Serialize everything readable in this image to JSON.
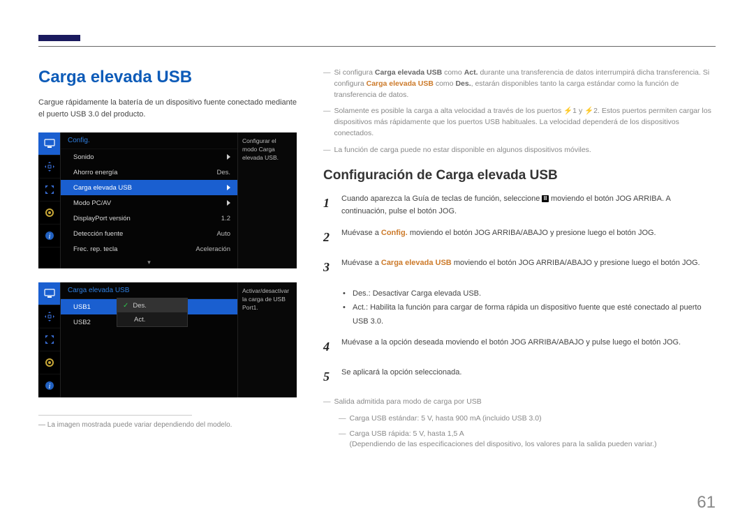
{
  "page_number": "61",
  "title": "Carga elevada USB",
  "intro": "Cargue rápidamente la batería de un dispositivo fuente conectado mediante el puerto USB 3.0 del producto.",
  "footnote": "La imagen mostrada puede variar dependiendo del modelo.",
  "osd1": {
    "header": "Config.",
    "description": "Configurar el modo Carga elevada USB.",
    "items": [
      {
        "label": "Sonido",
        "value": "",
        "arrow": true
      },
      {
        "label": "Ahorro energía",
        "value": "Des.",
        "arrow": false
      },
      {
        "label": "Carga elevada USB",
        "value": "",
        "arrow": true,
        "selected": true
      },
      {
        "label": "Modo PC/AV",
        "value": "",
        "arrow": true
      },
      {
        "label": "DisplayPort versión",
        "value": "1.2",
        "arrow": false
      },
      {
        "label": "Detección fuente",
        "value": "Auto",
        "arrow": false
      },
      {
        "label": "Frec. rep. tecla",
        "value": "Aceleración",
        "arrow": false
      }
    ]
  },
  "osd2": {
    "header": "Carga elevada USB",
    "description": "Activar/desactivar la carga de USB Port1.",
    "items": [
      {
        "label": "USB1",
        "selected": true
      },
      {
        "label": "USB2"
      }
    ],
    "options": [
      {
        "label": "Des.",
        "checked": true
      },
      {
        "label": "Act."
      }
    ]
  },
  "notes_top": {
    "n1_pre": "Si configura ",
    "n1_b1": "Carga elevada USB",
    "n1_mid1": " como ",
    "n1_b2": "Act.",
    "n1_mid2": " durante una transferencia de datos interrumpirá dicha transferencia. Si configura ",
    "n1_b3": "Carga elevada USB",
    "n1_mid3": " como ",
    "n1_b4": "Des.",
    "n1_end": ", estarán disponibles tanto la carga estándar como la función de transferencia de datos.",
    "n2": "Solamente es posible la carga a alta velocidad a través de los puertos ⚡1 y ⚡2. Estos puertos permiten cargar los dispositivos más rápidamente que los puertos USB habituales. La velocidad dependerá de los dispositivos conectados.",
    "n3": "La función de carga puede no estar disponible en algunos dispositivos móviles."
  },
  "section2_title": "Configuración de Carga elevada USB",
  "steps": {
    "s1_a": "Cuando aparezca la Guía de teclas de función, seleccione ",
    "s1_b": " moviendo el botón JOG ARRIBA. A continuación, pulse el botón JOG.",
    "s2_a": "Muévase a ",
    "s2_b": "Config.",
    "s2_c": " moviendo el botón JOG ARRIBA/ABAJO y presione luego el botón JOG.",
    "s3_a": "Muévase a ",
    "s3_b": "Carga elevada USB",
    "s3_c": " moviendo el botón JOG ARRIBA/ABAJO y presione luego el botón JOG.",
    "s4": "Muévase a la opción deseada moviendo el botón JOG ARRIBA/ABAJO y pulse luego el botón JOG.",
    "s5": "Se aplicará la opción seleccionada."
  },
  "bullets": {
    "b1_a": "Des.",
    "b1_b": ": Desactivar ",
    "b1_c": "Carga elevada USB",
    "b1_d": ".",
    "b2_a": "Act.",
    "b2_b": ": Habilita la función para cargar de forma rápida un dispositivo fuente que esté conectado al puerto USB 3.0."
  },
  "notes_bottom": {
    "t": "Salida admitida para modo de carga por USB",
    "l1": "Carga USB estándar: 5 V, hasta 900 mA (incluido USB 3.0)",
    "l2a": "Carga USB rápida: 5 V, hasta 1,5 A",
    "l2b": "(Dependiendo de las especificaciones del dispositivo, los valores para la salida pueden variar.)"
  }
}
